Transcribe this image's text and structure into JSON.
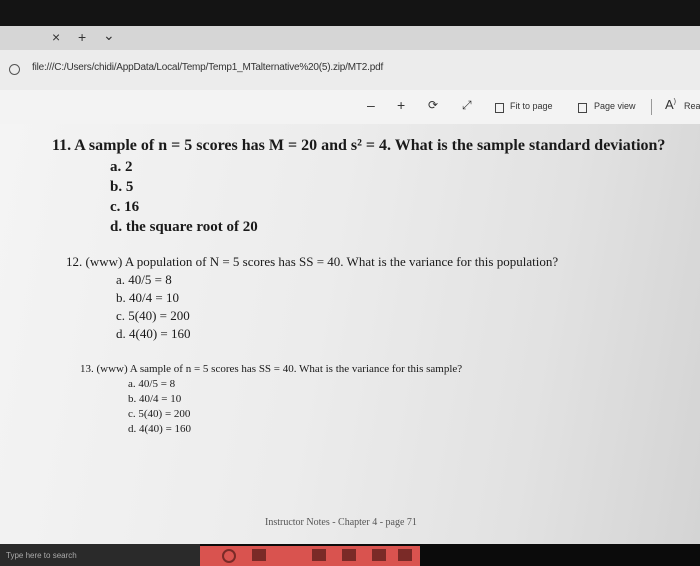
{
  "browser": {
    "tab_close": "×",
    "tab_add": "+",
    "tab_menu": "⌄",
    "url": "file:///C:/Users/chidi/AppData/Local/Temp/Temp1_MTalternative%20(5).zip/MT2.pdf"
  },
  "pdf_toolbar": {
    "zoom_out": "–",
    "zoom_in": "+",
    "fit_to_page": "Fit to page",
    "page_view": "Page view",
    "read_aloud": "Rea"
  },
  "document": {
    "q11": {
      "text": "11.  A sample of n = 5 scores has M = 20 and s² = 4.  What is the sample standard deviation?",
      "options": [
        "a.  2",
        "b.  5",
        "c.  16",
        "d.  the square root of 20"
      ]
    },
    "q12": {
      "text": "12.  (www)  A population of N = 5 scores has SS = 40.  What is the variance for this population?",
      "options": [
        "a.  40/5 = 8",
        "b.  40/4 = 10",
        "c.  5(40) = 200",
        "d.  4(40) = 160"
      ]
    },
    "q13": {
      "text": "13.  (www)  A sample of n = 5 scores has SS = 40.  What is the variance for this sample?",
      "options": [
        "a.  40/5 = 8",
        "b.  40/4 = 10",
        "c.  5(40) = 200",
        "d.  4(40) = 160"
      ]
    },
    "footer": "Instructor Notes  -  Chapter 4  -  page 71"
  },
  "taskbar": {
    "search_placeholder": "Type here to search"
  }
}
